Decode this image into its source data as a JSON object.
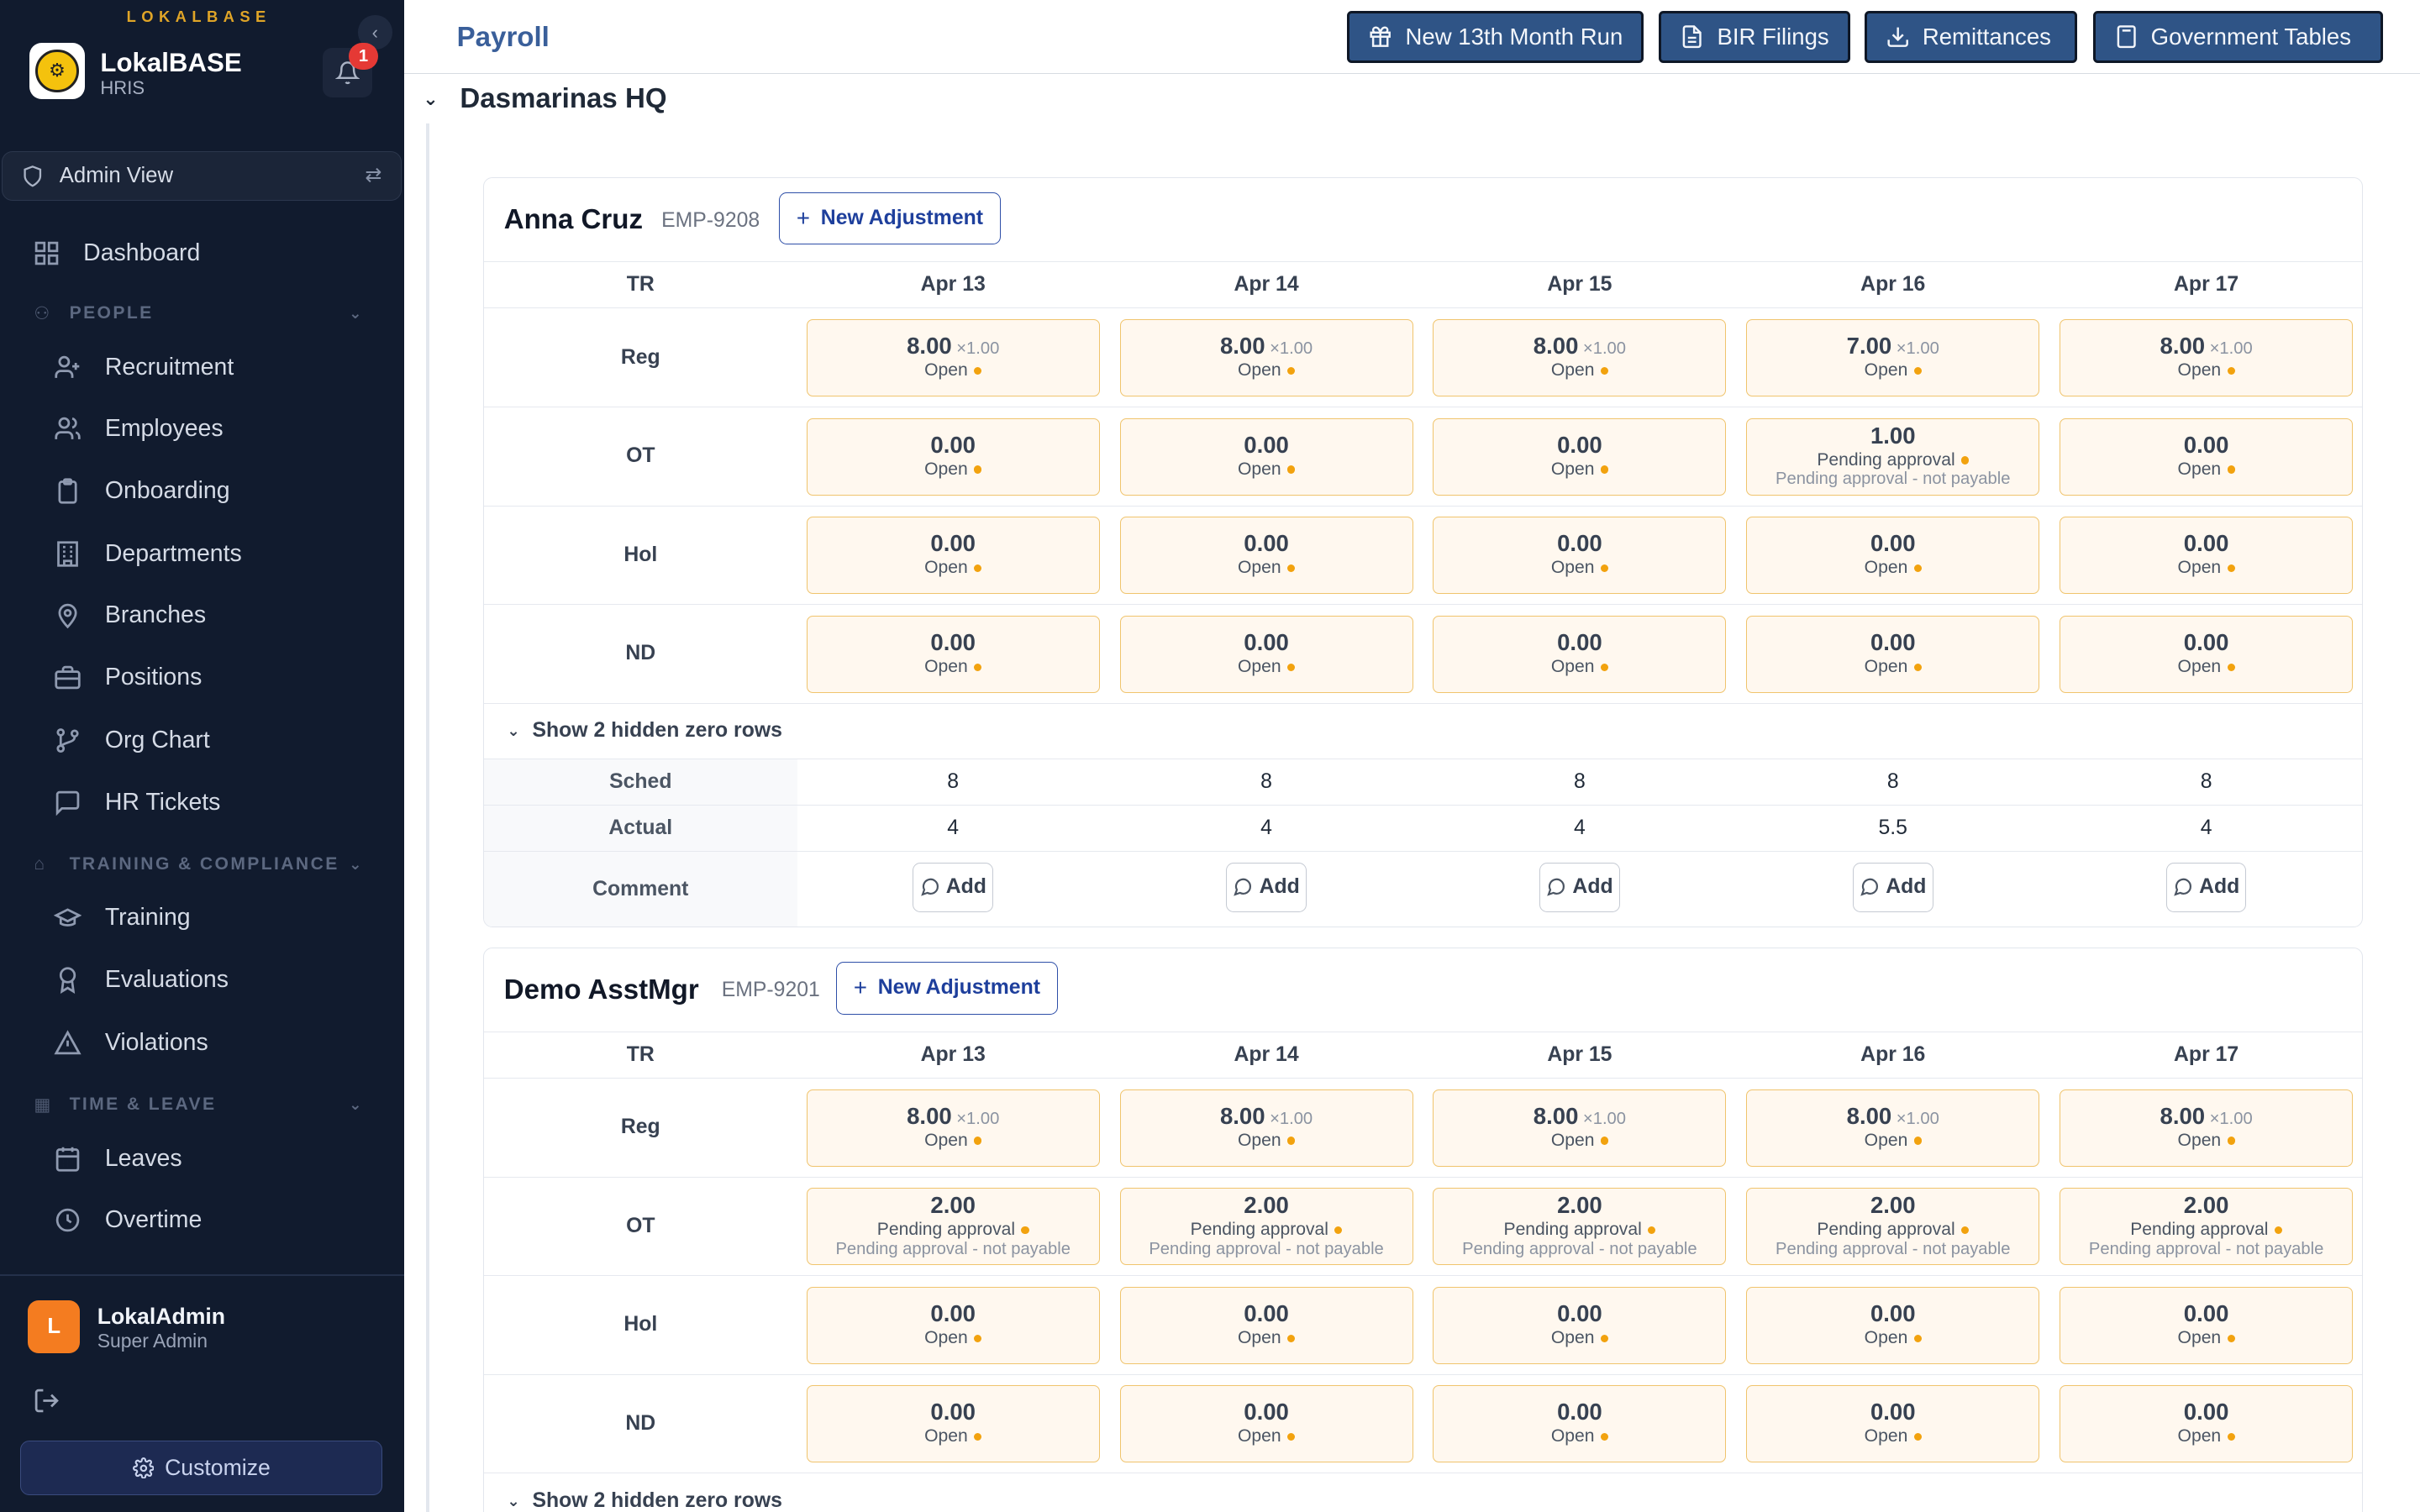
{
  "sidebar": {
    "brand_tag": "LOKALBASE",
    "brand_name": "LokalBASE",
    "brand_sub": "HRIS",
    "notifications_count": "1",
    "view_label": "Admin View",
    "dashboard": "Dashboard",
    "sections": {
      "people": "PEOPLE",
      "training": "TRAINING & COMPLIANCE",
      "time": "TIME & LEAVE"
    },
    "items": {
      "recruitment": "Recruitment",
      "employees": "Employees",
      "onboarding": "Onboarding",
      "departments": "Departments",
      "branches": "Branches",
      "positions": "Positions",
      "org_chart": "Org Chart",
      "hr_tickets": "HR Tickets",
      "training": "Training",
      "evaluations": "Evaluations",
      "violations": "Violations",
      "leaves": "Leaves",
      "overtime": "Overtime"
    },
    "user": {
      "initial": "L",
      "name": "LokalAdmin",
      "role": "Super Admin"
    },
    "customize": "Customize"
  },
  "header": {
    "title": "Payroll",
    "buttons": {
      "thirteenth": "New 13th Month Run",
      "bir": "BIR Filings",
      "remittances": "Remittances",
      "gov_tables": "Government Tables"
    }
  },
  "main": {
    "group": "Dasmarinas HQ",
    "tr_label": "TR",
    "dates": [
      "Apr 13",
      "Apr 14",
      "Apr 15",
      "Apr 16",
      "Apr 17"
    ],
    "row_labels": {
      "reg": "Reg",
      "ot": "OT",
      "hol": "Hol",
      "nd": "ND"
    },
    "hidden_toggle": "Show 2 hidden zero rows",
    "summary_labels": {
      "sched": "Sched",
      "actual": "Actual",
      "comment": "Comment"
    },
    "add_label": "Add",
    "new_adjustment": "New Adjustment",
    "multiplier": "×1.00",
    "not_payable": "Pending approval - not payable",
    "employees": [
      {
        "name": "Anna Cruz",
        "id": "EMP-9208",
        "reg": [
          {
            "v": "8.00",
            "s": "Open"
          },
          {
            "v": "8.00",
            "s": "Open"
          },
          {
            "v": "8.00",
            "s": "Open"
          },
          {
            "v": "7.00",
            "s": "Open"
          },
          {
            "v": "8.00",
            "s": "Open"
          }
        ],
        "ot": [
          {
            "v": "0.00",
            "s": "Open"
          },
          {
            "v": "0.00",
            "s": "Open"
          },
          {
            "v": "0.00",
            "s": "Open"
          },
          {
            "v": "1.00",
            "s": "Pending approval"
          },
          {
            "v": "0.00",
            "s": "Open"
          }
        ],
        "hol": [
          {
            "v": "0.00",
            "s": "Open"
          },
          {
            "v": "0.00",
            "s": "Open"
          },
          {
            "v": "0.00",
            "s": "Open"
          },
          {
            "v": "0.00",
            "s": "Open"
          },
          {
            "v": "0.00",
            "s": "Open"
          }
        ],
        "nd": [
          {
            "v": "0.00",
            "s": "Open"
          },
          {
            "v": "0.00",
            "s": "Open"
          },
          {
            "v": "0.00",
            "s": "Open"
          },
          {
            "v": "0.00",
            "s": "Open"
          },
          {
            "v": "0.00",
            "s": "Open"
          }
        ],
        "sched": [
          "8",
          "8",
          "8",
          "8",
          "8"
        ],
        "actual": [
          "4",
          "4",
          "4",
          "5.5",
          "4"
        ]
      },
      {
        "name": "Demo AsstMgr",
        "id": "EMP-9201",
        "reg": [
          {
            "v": "8.00",
            "s": "Open"
          },
          {
            "v": "8.00",
            "s": "Open"
          },
          {
            "v": "8.00",
            "s": "Open"
          },
          {
            "v": "8.00",
            "s": "Open"
          },
          {
            "v": "8.00",
            "s": "Open"
          }
        ],
        "ot": [
          {
            "v": "2.00",
            "s": "Pending approval"
          },
          {
            "v": "2.00",
            "s": "Pending approval"
          },
          {
            "v": "2.00",
            "s": "Pending approval"
          },
          {
            "v": "2.00",
            "s": "Pending approval"
          },
          {
            "v": "2.00",
            "s": "Pending approval"
          }
        ],
        "hol": [
          {
            "v": "0.00",
            "s": "Open"
          },
          {
            "v": "0.00",
            "s": "Open"
          },
          {
            "v": "0.00",
            "s": "Open"
          },
          {
            "v": "0.00",
            "s": "Open"
          },
          {
            "v": "0.00",
            "s": "Open"
          }
        ],
        "nd": [
          {
            "v": "0.00",
            "s": "Open"
          },
          {
            "v": "0.00",
            "s": "Open"
          },
          {
            "v": "0.00",
            "s": "Open"
          },
          {
            "v": "0.00",
            "s": "Open"
          },
          {
            "v": "0.00",
            "s": "Open"
          }
        ]
      }
    ]
  }
}
